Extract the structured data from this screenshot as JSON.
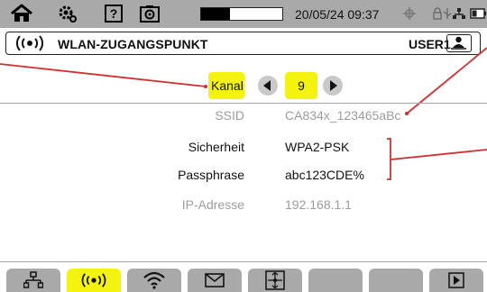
{
  "status_bar": {
    "datetime": "20/05/24 09:37",
    "progress_fraction": 0.35
  },
  "header": {
    "title": "WLAN-ZUGANGSPUNKT",
    "user": "USER1"
  },
  "channel": {
    "label": "Kanal",
    "value": "9"
  },
  "fields": [
    {
      "label": "SSID",
      "value": "CA834x_123465aBc"
    },
    {
      "label": "Sicherheit",
      "value": "WPA2-PSK"
    },
    {
      "label": "Passphrase",
      "value": "abc123CDE%"
    },
    {
      "label": "IP-Adresse",
      "value": "192.168.1.1"
    }
  ],
  "colors": {
    "highlight": "#f3f30f",
    "bar_gray": "#a9a9a9",
    "callout_red": "#d32f2f",
    "disabled_text": "#9c9c9c"
  },
  "tabs": [
    {
      "icon": "network-icon",
      "active": false
    },
    {
      "icon": "wifi-access-point-icon",
      "active": true
    },
    {
      "icon": "wifi-icon",
      "active": false
    },
    {
      "icon": "envelope-icon",
      "active": false
    },
    {
      "icon": "sync-icon",
      "active": false
    },
    {
      "icon": "",
      "active": false
    },
    {
      "icon": "",
      "active": false
    },
    {
      "icon": "play-icon",
      "active": false
    }
  ]
}
